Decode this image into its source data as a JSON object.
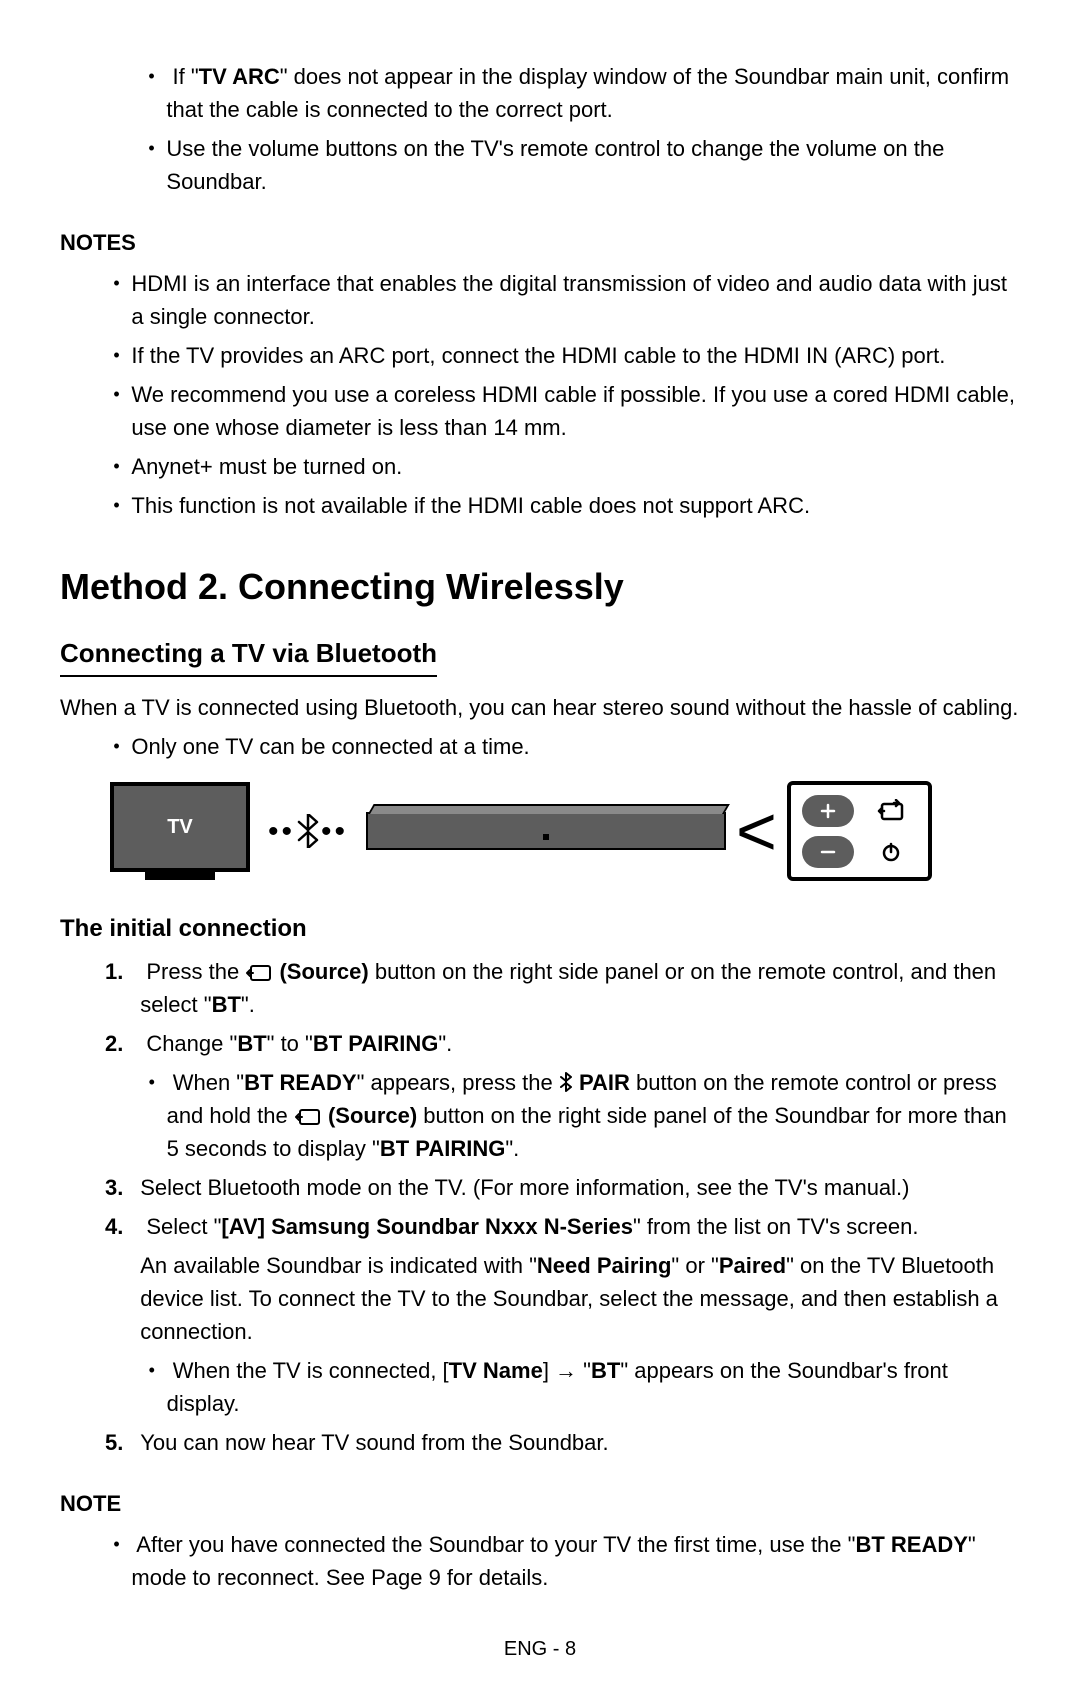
{
  "intro_bullets": {
    "tv_arc_prefix": "If \"",
    "tv_arc_bold": "TV ARC",
    "tv_arc_suffix": "\" does not appear in the display window of the Soundbar main unit, confirm that the cable is connected to the correct port.",
    "volume": "Use the volume buttons on the TV's remote control to change the volume on the Soundbar."
  },
  "notes_heading": "NOTES",
  "notes": [
    "HDMI is an interface that enables the digital transmission of video and audio data with just a single connector.",
    "If the TV provides an ARC port, connect the HDMI cable to the HDMI IN (ARC) port.",
    "We recommend you use a coreless HDMI cable if possible. If you use a cored HDMI cable, use one whose diameter is less than 14 mm.",
    "Anynet+ must be turned on.",
    "This function is not available if the HDMI cable does not support ARC."
  ],
  "section_heading": "Method 2. Connecting Wirelessly",
  "subsection_heading": "Connecting a TV via Bluetooth",
  "subsection_intro": "When a TV is connected using Bluetooth, you can hear stereo sound without the hassle of cabling.",
  "subsection_bullet": "Only one TV can be connected at a time.",
  "diagram": {
    "tv_label": "TV"
  },
  "initial_heading": "The initial connection",
  "steps": {
    "s1_a": "Press the ",
    "s1_source": "(Source)",
    "s1_b": " button on the right side panel or on the remote control, and then select \"",
    "s1_bt": "BT",
    "s1_c": "\".",
    "s2_a": "Change \"",
    "s2_bt": "BT",
    "s2_b": "\" to \"",
    "s2_btpairing": "BT PAIRING",
    "s2_c": "\".",
    "s2_sub_a": "When \"",
    "s2_sub_btready": "BT READY",
    "s2_sub_b": "\" appears, press the ",
    "s2_sub_pair": "PAIR",
    "s2_sub_c": " button on the remote control or press and hold the ",
    "s2_sub_source": "(Source)",
    "s2_sub_d": " button on the right side panel of the Soundbar for more than 5 seconds to display \"",
    "s2_sub_btpairing": "BT PAIRING",
    "s2_sub_e": "\".",
    "s3": "Select Bluetooth mode on the TV. (For more information, see the TV's manual.)",
    "s4_a": "Select \"",
    "s4_bold": "[AV] Samsung Soundbar Nxxx N-Series",
    "s4_b": "\" from the list on TV's screen.",
    "s4_line2_a": "An available Soundbar is indicated with \"",
    "s4_line2_need": "Need Pairing",
    "s4_line2_b": "\" or \"",
    "s4_line2_paired": "Paired",
    "s4_line2_c": "\" on the TV Bluetooth device list. To connect the TV to the Soundbar, select the message, and then establish a connection.",
    "s4_sub_a": "When the TV is connected, [",
    "s4_sub_tvname": "TV Name",
    "s4_sub_b": "] → \"",
    "s4_sub_bt": "BT",
    "s4_sub_c": "\" appears on the Soundbar's front display.",
    "s5": "You can now hear TV sound from the Soundbar."
  },
  "note_heading": "NOTE",
  "note": {
    "a": "After you have connected the Soundbar to your TV the first time, use the \"",
    "btready": "BT READY",
    "b": "\" mode to reconnect. See Page 9 for details."
  },
  "footer": "ENG - 8"
}
